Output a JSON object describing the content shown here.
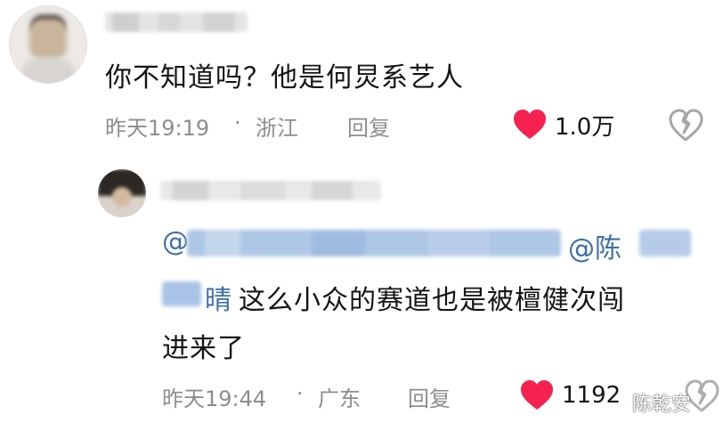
{
  "comment1": {
    "text": "你不知道吗？他是何炅系艺人",
    "date": "昨天19:19",
    "separator": "·",
    "location": "浙江",
    "reply_label": "回复",
    "likes": "1.0万",
    "icons": {
      "like": "heart-icon",
      "dislike": "broken-heart-icon"
    }
  },
  "comment2": {
    "mention_prefix": "@",
    "mention2_prefix": "@陈",
    "name_tail": "晴",
    "text_line1": "这么小众的赛道也是被檀健次闯",
    "text_line2": "进来了",
    "date": "昨天19:44",
    "separator": "·",
    "location": "广东",
    "reply_label": "回复",
    "likes": "1192",
    "icons": {
      "like": "heart-icon",
      "dislike": "broken-heart-icon"
    }
  },
  "colors": {
    "like_red": "#f5224f",
    "mention_blue": "#3d6fa8",
    "meta_gray": "#8d8d8d"
  },
  "watermark": "陈乾安"
}
